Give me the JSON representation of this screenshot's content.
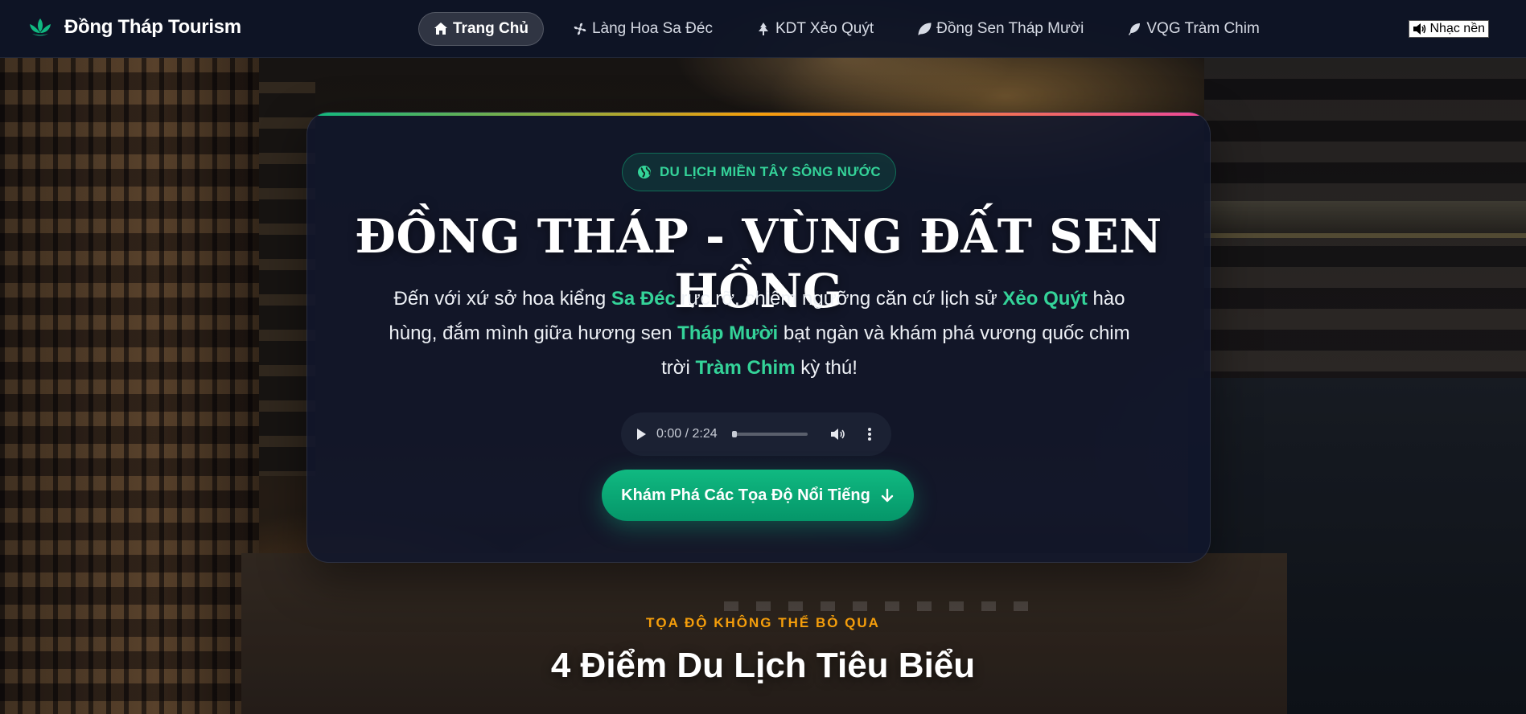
{
  "brand": {
    "name": "Đồng Tháp Tourism",
    "icon": "lotus-icon",
    "accent": "#10b981"
  },
  "nav": {
    "items": [
      {
        "label": "Trang Chủ",
        "icon": "home-icon",
        "active": true
      },
      {
        "label": "Làng Hoa Sa Đéc",
        "icon": "fan-icon",
        "active": false
      },
      {
        "label": "KDT Xẻo Quýt",
        "icon": "tree-icon",
        "active": false
      },
      {
        "label": "Đồng Sen Tháp Mười",
        "icon": "leaf-icon",
        "active": false
      },
      {
        "label": "VQG Tràm Chim",
        "icon": "feather-icon",
        "active": false
      }
    ],
    "music_label": "Nhạc nền",
    "music_icon": "speaker-icon"
  },
  "hero": {
    "badge": "DU LỊCH MIỀN TÂY SÔNG NƯỚC",
    "badge_icon": "globe-icon",
    "title": "ĐỒNG THÁP - VÙNG ĐẤT SEN HỒNG",
    "desc": {
      "p1": "Đến với xứ sở hoa kiểng ",
      "h1": "Sa Đéc",
      "p2": " rực rỡ, chiêm ngưỡng căn cứ lịch sử ",
      "h2": "Xẻo Quýt",
      "p3": " hào hùng, đắm mình giữa hương sen ",
      "h3": "Tháp Mười",
      "p4": " bạt ngàn và khám phá vương quốc chim trời ",
      "h4": "Tràm Chim",
      "p5": " kỳ thú!"
    },
    "audio": {
      "time": "0:00 / 2:24"
    },
    "cta_label": "Khám Phá Các Tọa Độ Nổi Tiếng"
  },
  "section": {
    "kicker": "TỌA ĐỘ KHÔNG THỂ BỎ QUA",
    "title": "4 Điểm Du Lịch Tiêu Biểu"
  },
  "colors": {
    "gradient_start": "#10b981",
    "gradient_mid": "#f59e0b",
    "gradient_end": "#ec4899",
    "highlight": "#34d399",
    "kicker": "#f59e0b"
  }
}
